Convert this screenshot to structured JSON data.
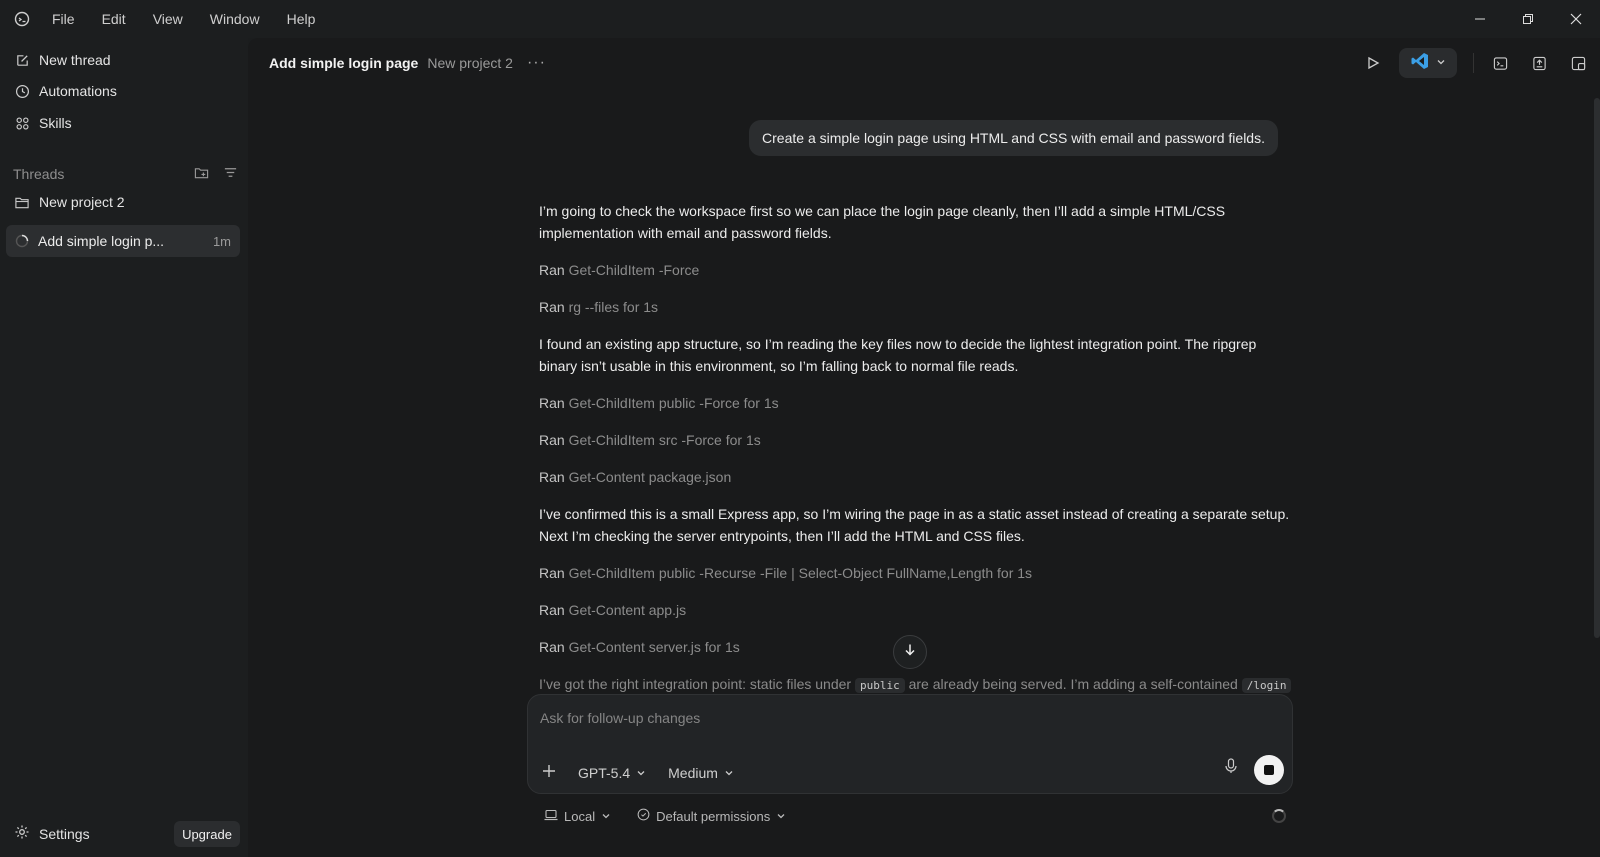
{
  "menu": [
    "File",
    "Edit",
    "View",
    "Window",
    "Help"
  ],
  "sidebar": {
    "nav": [
      {
        "label": "New thread",
        "icon": "edit-icon"
      },
      {
        "label": "Automations",
        "icon": "clock-icon"
      },
      {
        "label": "Skills",
        "icon": "grid-icon"
      }
    ],
    "threads_header": "Threads",
    "project": "New project 2",
    "active_thread": {
      "label": "Add simple login p...",
      "age": "1m"
    },
    "settings_label": "Settings",
    "upgrade_label": "Upgrade"
  },
  "header": {
    "title": "Add simple login page",
    "project": "New project 2",
    "more": "···"
  },
  "conversation": {
    "user_message": "Create a simple login page using HTML and CSS with email and password fields.",
    "p1": "I’m going to check the workspace first so we can place the login page cleanly, then I’ll add a simple HTML/CSS implementation with email and password fields.",
    "runs1": [
      {
        "prefix": "Ran",
        "cmd": "Get-ChildItem -Force"
      },
      {
        "prefix": "Ran",
        "cmd": "rg --files for 1s"
      }
    ],
    "p2": "I found an existing app structure, so I’m reading the key files now to decide the lightest integration point. The ripgrep binary isn’t usable in this environment, so I’m falling back to normal file reads.",
    "runs2": [
      {
        "prefix": "Ran",
        "cmd": "Get-ChildItem public -Force for 1s"
      },
      {
        "prefix": "Ran",
        "cmd": "Get-ChildItem src -Force for 1s"
      },
      {
        "prefix": "Ran",
        "cmd": "Get-Content package.json"
      }
    ],
    "p3": "I’ve confirmed this is a small Express app, so I’m wiring the page in as a static asset instead of creating a separate setup. Next I’m checking the server entrypoints, then I’ll add the HTML and CSS files.",
    "runs3": [
      {
        "prefix": "Ran",
        "cmd": "Get-ChildItem public -Recurse -File | Select-Object FullName,Length for 1s"
      },
      {
        "prefix": "Ran",
        "cmd": "Get-Content app.js"
      },
      {
        "prefix": "Ran",
        "cmd": "Get-Content server.js for 1s"
      }
    ],
    "p4_a": "I’ve got the right integration point: static files under",
    "p4_code1": "public",
    "p4_b": "are already being served. I’m adding a self-contained",
    "p4_code2": "/login"
  },
  "composer": {
    "placeholder": "Ask for follow-up changes",
    "model": "GPT-5.4",
    "effort": "Medium"
  },
  "footer": {
    "location": "Local",
    "permissions": "Default permissions"
  },
  "colors": {
    "accent_vscode": "#3b9fe6",
    "background": "#191a1b",
    "sidebar": "#1c1e1f"
  }
}
